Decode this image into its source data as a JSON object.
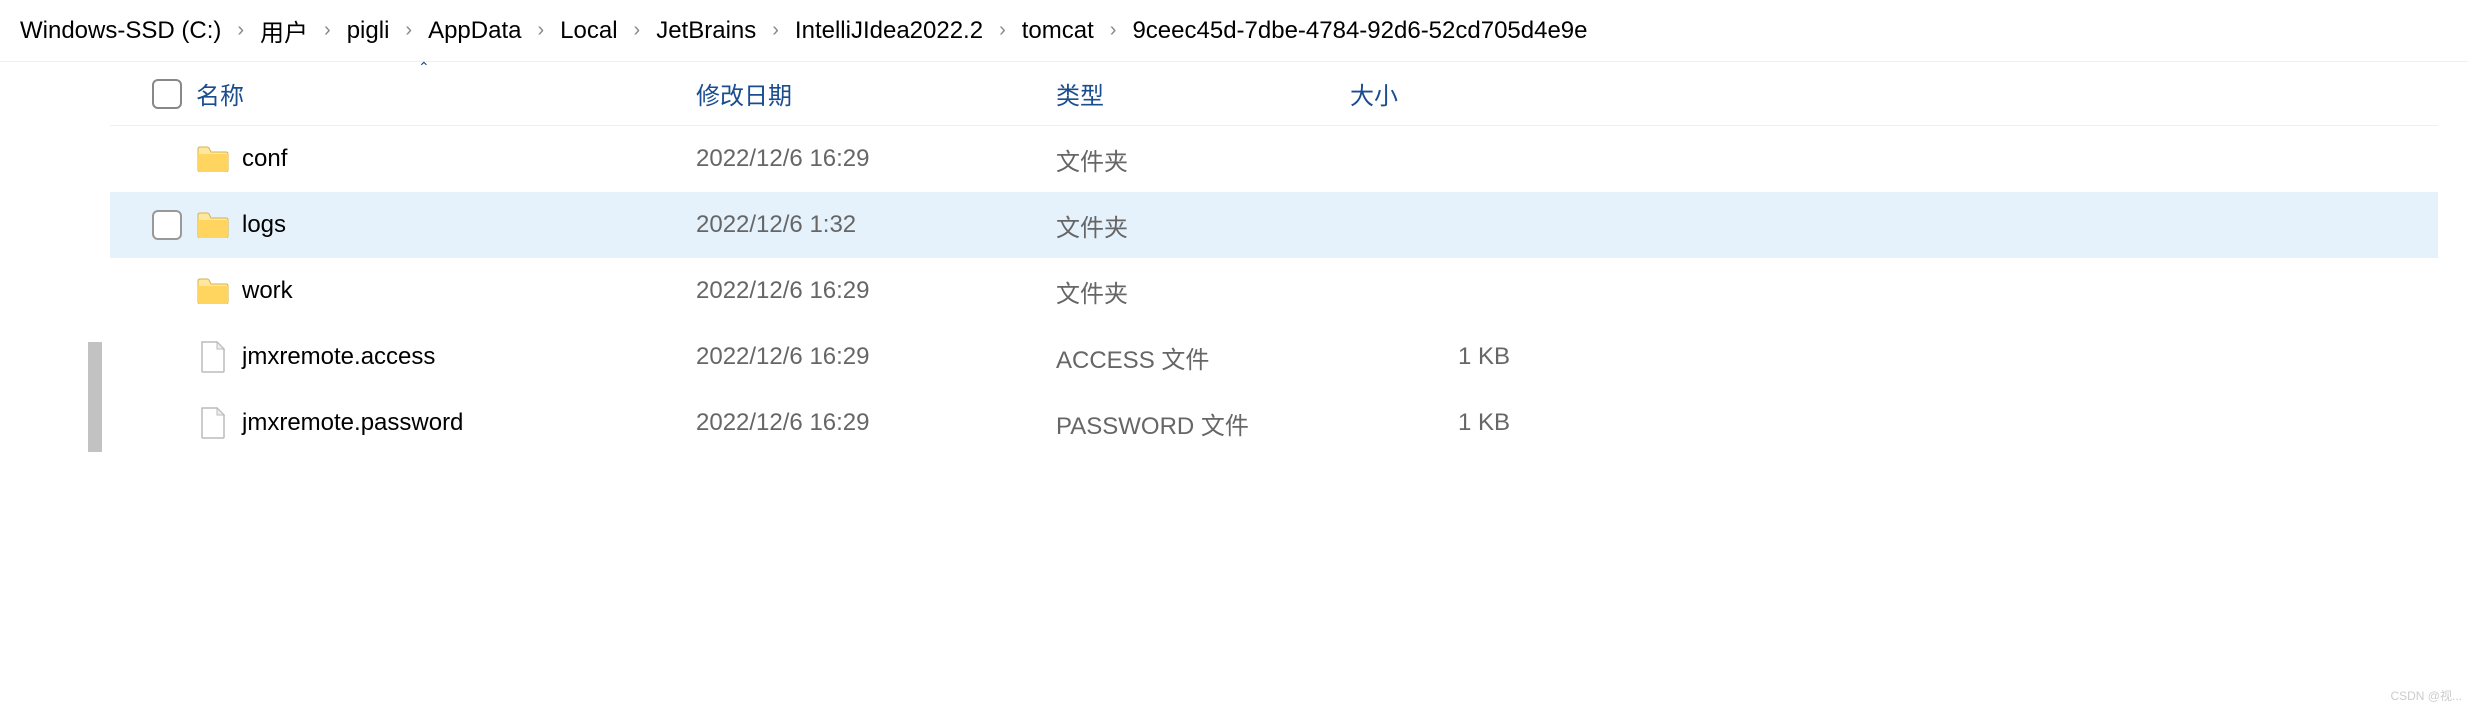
{
  "breadcrumb": {
    "items": [
      "Windows-SSD (C:)",
      "用户",
      "pigli",
      "AppData",
      "Local",
      "JetBrains",
      "IntelliJIdea2022.2",
      "tomcat",
      "9ceec45d-7dbe-4784-92d6-52cd705d4e9e"
    ]
  },
  "columns": {
    "name": "名称",
    "date": "修改日期",
    "type": "类型",
    "size": "大小"
  },
  "rows": [
    {
      "icon": "folder",
      "name": "conf",
      "date": "2022/12/6 16:29",
      "type": "文件夹",
      "size": "",
      "selected": false
    },
    {
      "icon": "folder",
      "name": "logs",
      "date": "2022/12/6 1:32",
      "type": "文件夹",
      "size": "",
      "selected": true
    },
    {
      "icon": "folder",
      "name": "work",
      "date": "2022/12/6 16:29",
      "type": "文件夹",
      "size": "",
      "selected": false
    },
    {
      "icon": "file",
      "name": "jmxremote.access",
      "date": "2022/12/6 16:29",
      "type": "ACCESS 文件",
      "size": "1 KB",
      "selected": false
    },
    {
      "icon": "file",
      "name": "jmxremote.password",
      "date": "2022/12/6 16:29",
      "type": "PASSWORD 文件",
      "size": "1 KB",
      "selected": false
    }
  ],
  "watermark": "CSDN @视..."
}
